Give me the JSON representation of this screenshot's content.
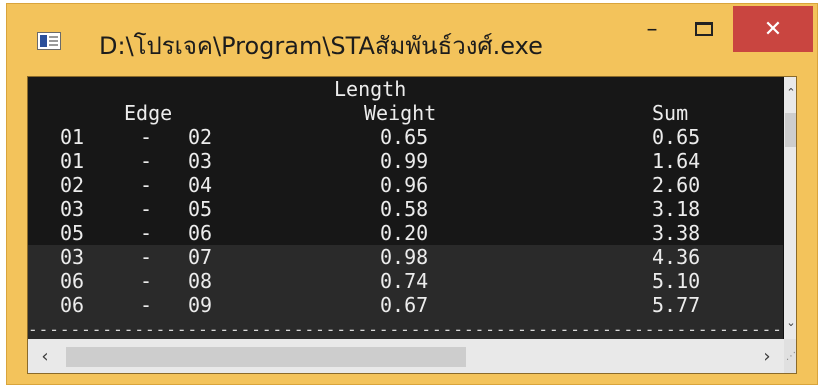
{
  "window": {
    "title": "D:\\โปรเจค\\Program\\STAสัมพันธ์วงศ์.exe",
    "controls": {
      "minimize": "–",
      "close": "✕"
    },
    "colors": {
      "frame": "#f3c35b",
      "close_button": "#c94540",
      "console_bg": "#171717",
      "console_text": "#ececec"
    }
  },
  "console": {
    "header": {
      "length": "Length",
      "edge": "Edge",
      "weight": "Weight",
      "sum": "Sum"
    },
    "separator": "-",
    "rows": [
      {
        "from": "01",
        "to": "02",
        "weight": "0.65",
        "sum": "0.65"
      },
      {
        "from": "01",
        "to": "03",
        "weight": "0.99",
        "sum": "1.64"
      },
      {
        "from": "02",
        "to": "04",
        "weight": "0.96",
        "sum": "2.60"
      },
      {
        "from": "03",
        "to": "05",
        "weight": "0.58",
        "sum": "3.18"
      },
      {
        "from": "05",
        "to": "06",
        "weight": "0.20",
        "sum": "3.38"
      },
      {
        "from": "03",
        "to": "07",
        "weight": "0.98",
        "sum": "4.36"
      },
      {
        "from": "06",
        "to": "08",
        "weight": "0.74",
        "sum": "5.10"
      },
      {
        "from": "06",
        "to": "09",
        "weight": "0.67",
        "sum": "5.77"
      }
    ],
    "footer_line": "--------------------------------------------------------------------------------------------------------"
  },
  "scrollbars": {
    "up_arrow": "⌃",
    "down_arrow": "⌄",
    "left_arrow": "‹",
    "right_arrow": "›",
    "grip": "⋰"
  }
}
